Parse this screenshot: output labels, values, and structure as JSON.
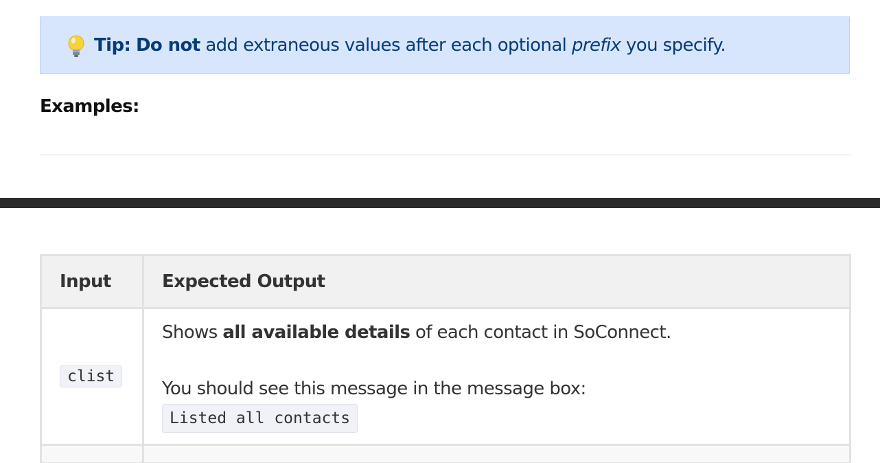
{
  "tip": {
    "label": "Tip:",
    "emphasis": "Do not",
    "text_before": "add extraneous values after each optional",
    "term": "prefix",
    "text_after": "you specify."
  },
  "examples_heading": "Examples:",
  "table": {
    "headers": [
      "Input",
      "Expected Output"
    ],
    "rows": [
      {
        "input": "clist",
        "output_prefix": "Shows",
        "output_bold": "all available details",
        "output_suffix": "of each contact in SoConnect.",
        "message_intro": "You should see this message in the message box:",
        "message_code": "Listed all contacts"
      }
    ]
  },
  "icons": {
    "tip": "lightbulb-icon"
  },
  "colors": {
    "tip_background": "#d7e6fd",
    "tip_text": "#073c78",
    "section_bar": "#2b2b2b",
    "table_header_bg": "#f1f1f1",
    "code_bg": "#f1f1f8"
  }
}
